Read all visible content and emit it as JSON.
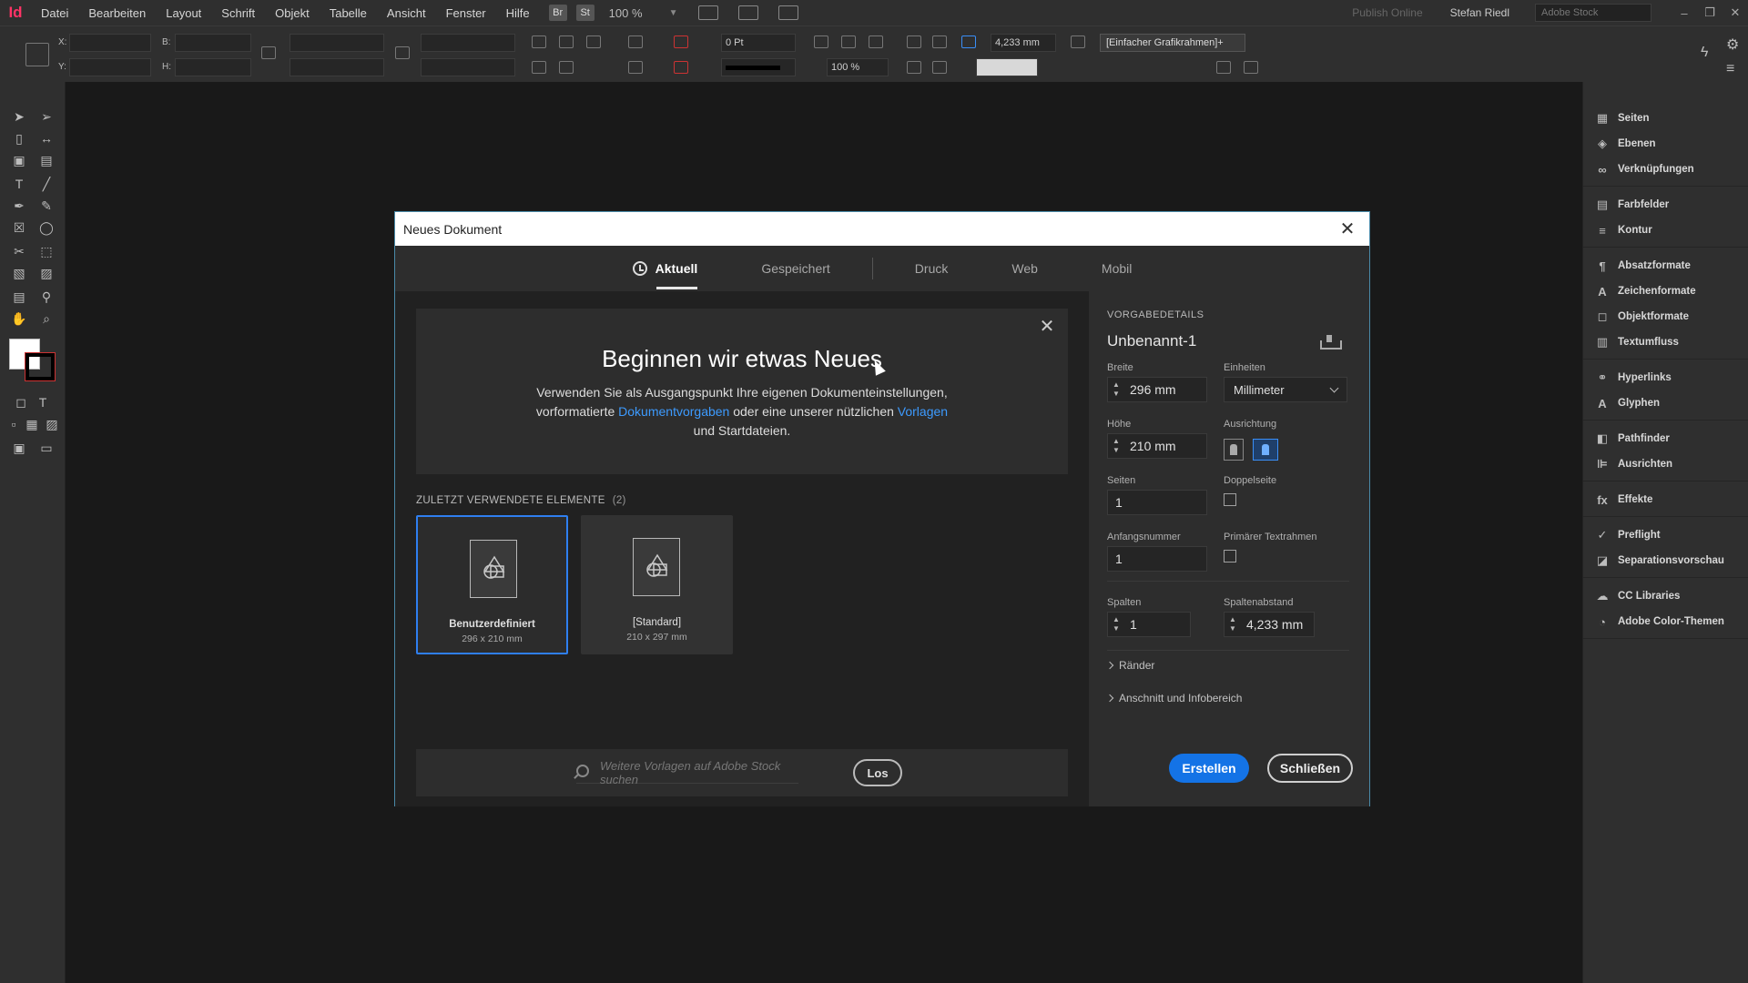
{
  "app": {
    "logo": "Id"
  },
  "menu": {
    "items": [
      "Datei",
      "Bearbeiten",
      "Layout",
      "Schrift",
      "Objekt",
      "Tabelle",
      "Ansicht",
      "Fenster",
      "Hilfe"
    ],
    "bridge_badge": "Br",
    "stock_badge": "St",
    "zoom": "100 %",
    "publish_online": "Publish Online",
    "user": "Stefan Riedl",
    "stock_search_placeholder": "Adobe Stock",
    "window_controls": [
      "–",
      "❐",
      "✕"
    ]
  },
  "controlbar": {
    "x_label": "X:",
    "y_label": "Y:",
    "w_label": "B:",
    "h_label": "H:",
    "stroke_weight": "0 Pt",
    "gutter_value": "4,233 mm",
    "scale_value": "100 %",
    "object_style": "[Einfacher Grafikrahmen]+"
  },
  "right_panels": [
    {
      "group": 1,
      "items": [
        {
          "label": "Seiten",
          "icon": "pages-icon",
          "glyph": "▦"
        },
        {
          "label": "Ebenen",
          "icon": "layers-icon",
          "glyph": "◈"
        },
        {
          "label": "Verknüpfungen",
          "icon": "links-icon",
          "glyph": "∞"
        }
      ]
    },
    {
      "group": 2,
      "items": [
        {
          "label": "Farbfelder",
          "icon": "swatches-icon",
          "glyph": "▤"
        },
        {
          "label": "Kontur",
          "icon": "stroke-icon",
          "glyph": "≡"
        }
      ]
    },
    {
      "group": 3,
      "items": [
        {
          "label": "Absatzformate",
          "icon": "paragraph-styles-icon",
          "glyph": "¶"
        },
        {
          "label": "Zeichenformate",
          "icon": "character-styles-icon",
          "glyph": "A"
        },
        {
          "label": "Objektformate",
          "icon": "object-styles-icon",
          "glyph": "◻"
        },
        {
          "label": "Textumfluss",
          "icon": "text-wrap-icon",
          "glyph": "▥"
        }
      ]
    },
    {
      "group": 4,
      "items": [
        {
          "label": "Hyperlinks",
          "icon": "hyperlinks-icon",
          "glyph": "⚭"
        },
        {
          "label": "Glyphen",
          "icon": "glyphs-icon",
          "glyph": "A"
        }
      ]
    },
    {
      "group": 5,
      "items": [
        {
          "label": "Pathfinder",
          "icon": "pathfinder-icon",
          "glyph": "◧"
        },
        {
          "label": "Ausrichten",
          "icon": "align-icon",
          "glyph": "⊫"
        }
      ]
    },
    {
      "group": 6,
      "items": [
        {
          "label": "Effekte",
          "icon": "effects-icon",
          "glyph": "fx"
        }
      ]
    },
    {
      "group": 7,
      "items": [
        {
          "label": "Preflight",
          "icon": "preflight-icon",
          "glyph": "✓"
        },
        {
          "label": "Separationsvorschau",
          "icon": "separations-icon",
          "glyph": "◪"
        }
      ]
    },
    {
      "group": 8,
      "items": [
        {
          "label": "CC Libraries",
          "icon": "cc-libraries-icon",
          "glyph": "☁"
        },
        {
          "label": "Adobe Color-Themen",
          "icon": "color-themes-icon",
          "glyph": "◔"
        }
      ]
    }
  ],
  "dialog": {
    "title": "Neues Dokument",
    "tabs": [
      "Aktuell",
      "Gespeichert",
      "Druck",
      "Web",
      "Mobil"
    ],
    "active_tab": "Aktuell",
    "hero": {
      "title": "Beginnen wir etwas Neues",
      "line1": "Verwenden Sie als Ausgangspunkt Ihre eigenen Dokumenteinstellungen,",
      "line2_pre": "vorformatierte ",
      "link1": "Dokumentvorgaben",
      "line2_mid": " oder eine unserer nützlichen ",
      "link2": "Vorlagen",
      "line3": "und Startdateien."
    },
    "recent": {
      "label": "ZULETZT VERWENDETE ELEMENTE",
      "count": "(2)",
      "items": [
        {
          "name": "Benutzerdefiniert",
          "size": "296 x 210 mm",
          "selected": true
        },
        {
          "name": "[Standard]",
          "size": "210 x 297 mm",
          "selected": false
        }
      ]
    },
    "stock_search": {
      "placeholder": "Weitere Vorlagen auf Adobe Stock suchen",
      "button": "Los"
    },
    "details": {
      "heading": "VORGABEDETAILS",
      "name": "Unbenannt-1",
      "width_label": "Breite",
      "width_value": "296 mm",
      "units_label": "Einheiten",
      "units_value": "Millimeter",
      "height_label": "Höhe",
      "height_value": "210 mm",
      "orientation_label": "Ausrichtung",
      "orientation": "landscape",
      "pages_label": "Seiten",
      "pages_value": "1",
      "facing_label": "Doppelseite",
      "facing_checked": false,
      "start_label": "Anfangsnummer",
      "start_value": "1",
      "primary_frame_label": "Primärer Textrahmen",
      "primary_frame_checked": false,
      "columns_label": "Spalten",
      "columns_value": "1",
      "gutter_label": "Spaltenabstand",
      "gutter_value": "4,233 mm",
      "margins_label": "Ränder",
      "bleed_label": "Anschnitt und Infobereich",
      "create_button": "Erstellen",
      "close_button": "Schließen"
    }
  },
  "colors": {
    "accent": "#1473e6",
    "link": "#3d9bff",
    "selection": "#2f7ff0",
    "app_logo": "#ff3366"
  }
}
